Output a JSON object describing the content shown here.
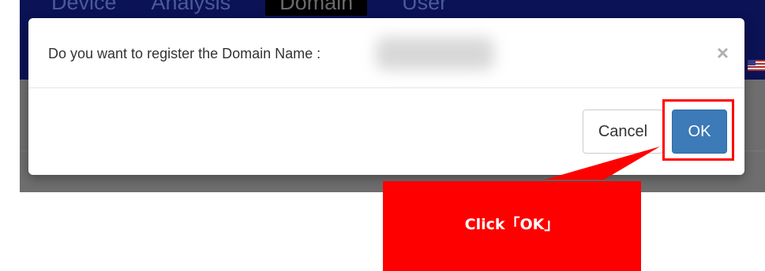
{
  "background": {
    "nav_items": [
      "Device",
      "Analysis",
      "Domain",
      "User"
    ],
    "active_nav": "Domain"
  },
  "dialog": {
    "message": "Do you want to register the Domain Name :",
    "close_symbol": "×",
    "cancel_label": "Cancel",
    "ok_label": "OK"
  },
  "annotation": {
    "callout_text": "Click「OK」",
    "color": "#ff0000"
  },
  "colors": {
    "navbar": "#0b1255",
    "ok_button": "#3c7ab8",
    "overlay_gray": "#6e6e6e"
  }
}
